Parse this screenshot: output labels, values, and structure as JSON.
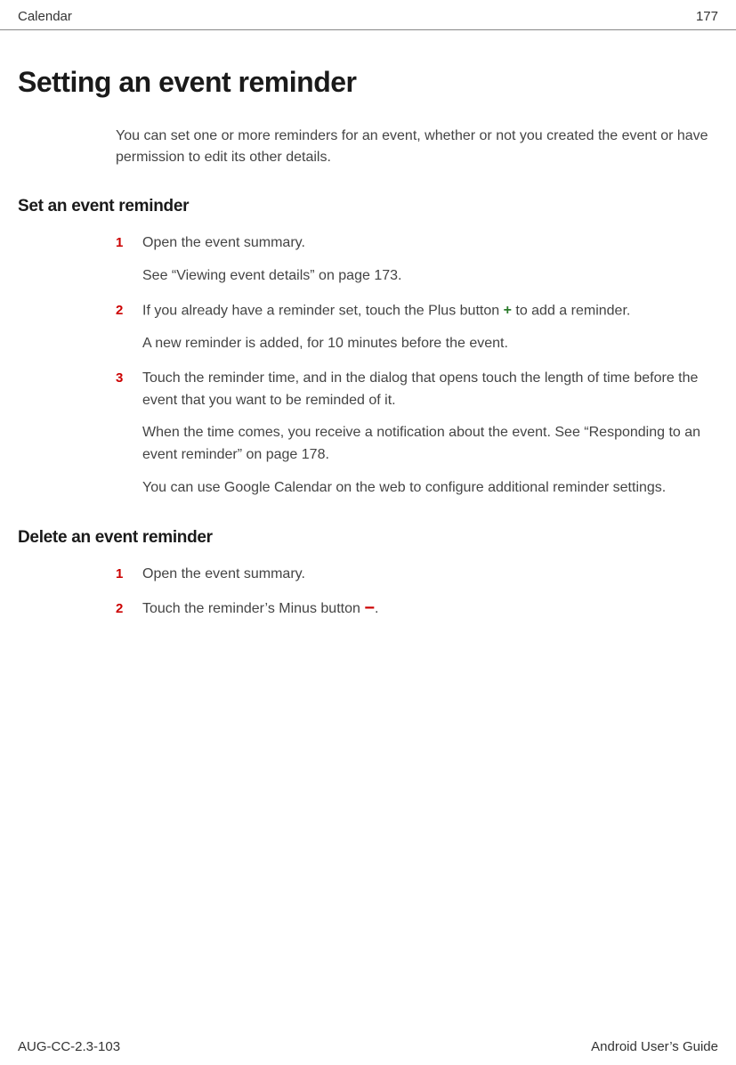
{
  "header": {
    "section": "Calendar",
    "page": "177"
  },
  "title": "Setting an event reminder",
  "intro": "You can set one or more reminders for an event, whether or not you created the event or have permission to edit its other details.",
  "section1": {
    "heading": "Set an event reminder",
    "steps": [
      {
        "num": "1",
        "p1": "Open the event summary.",
        "p2": "See “Viewing event details” on page 173."
      },
      {
        "num": "2",
        "p1a": "If you already have a reminder set, touch the Plus button ",
        "p1b": " to add a reminder.",
        "p2": "A new reminder is added, for 10 minutes before the event."
      },
      {
        "num": "3",
        "p1": "Touch the reminder time, and in the dialog that opens touch the length of time before the event that you want to be reminded of it.",
        "p2": "When the time comes, you receive a notification about the event. See “Responding to an event reminder” on page 178.",
        "p3": "You can use Google Calendar on the web to configure additional reminder settings."
      }
    ]
  },
  "section2": {
    "heading": "Delete an event reminder",
    "steps": [
      {
        "num": "1",
        "p1": "Open the event summary."
      },
      {
        "num": "2",
        "p1a": "Touch the reminder’s Minus button ",
        "p1b": "."
      }
    ]
  },
  "footer": {
    "left": "AUG-CC-2.3-103",
    "right": "Android User’s Guide"
  }
}
